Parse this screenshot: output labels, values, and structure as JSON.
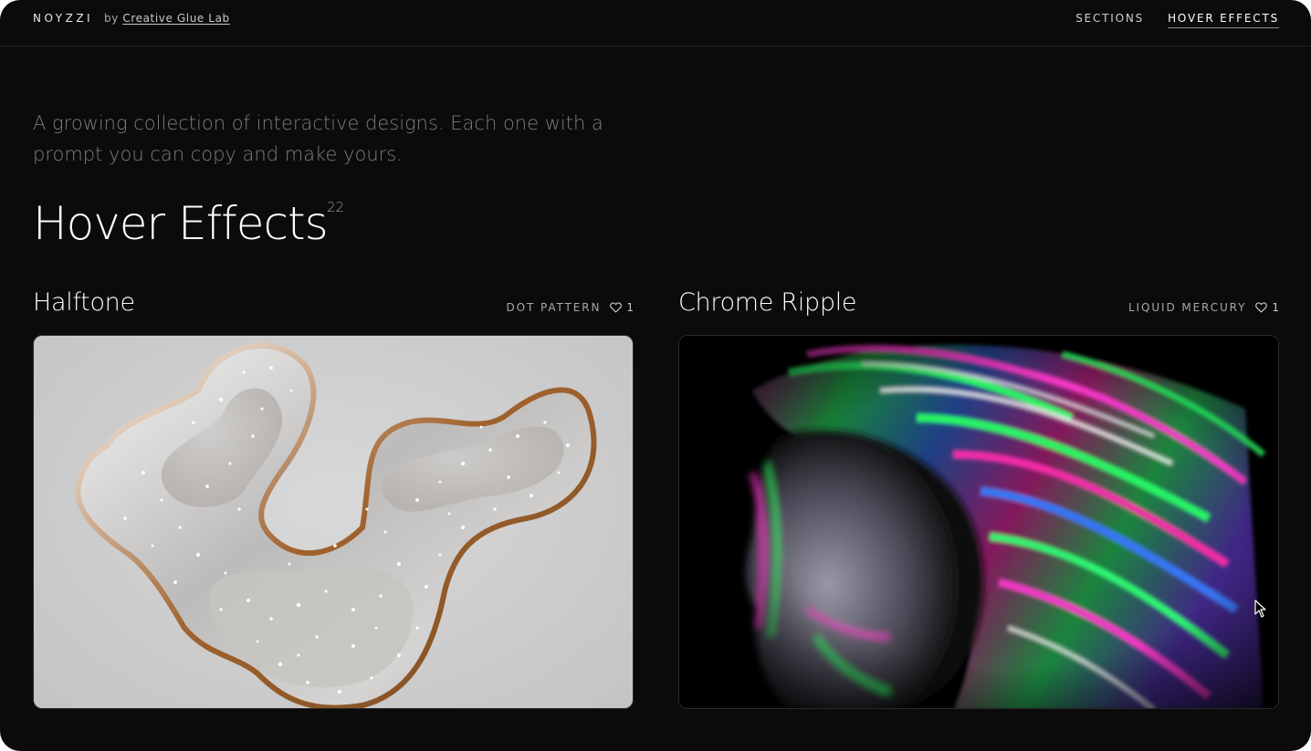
{
  "header": {
    "brand": "NOYZZI",
    "by_prefix": "by",
    "by_link": "Creative Glue Lab",
    "nav": [
      {
        "label": "SECTIONS",
        "active": false
      },
      {
        "label": "HOVER EFFECTS",
        "active": true
      }
    ]
  },
  "intro": {
    "text": "A growing collection of interactive designs. Each one with a prompt you can copy and make yours."
  },
  "page": {
    "title": "Hover Effects",
    "count": "22"
  },
  "cards": [
    {
      "title": "Halftone",
      "tag": "DOT PATTERN",
      "likes": "1",
      "icon": "heart-icon"
    },
    {
      "title": "Chrome Ripple",
      "tag": "LIQUID MERCURY",
      "likes": "1",
      "icon": "heart-icon"
    }
  ],
  "colors": {
    "background": "#0b0b0b",
    "text_primary": "#ffffff",
    "text_muted": "#7c7c7c",
    "halftone_bg": "#cdcdcd"
  }
}
